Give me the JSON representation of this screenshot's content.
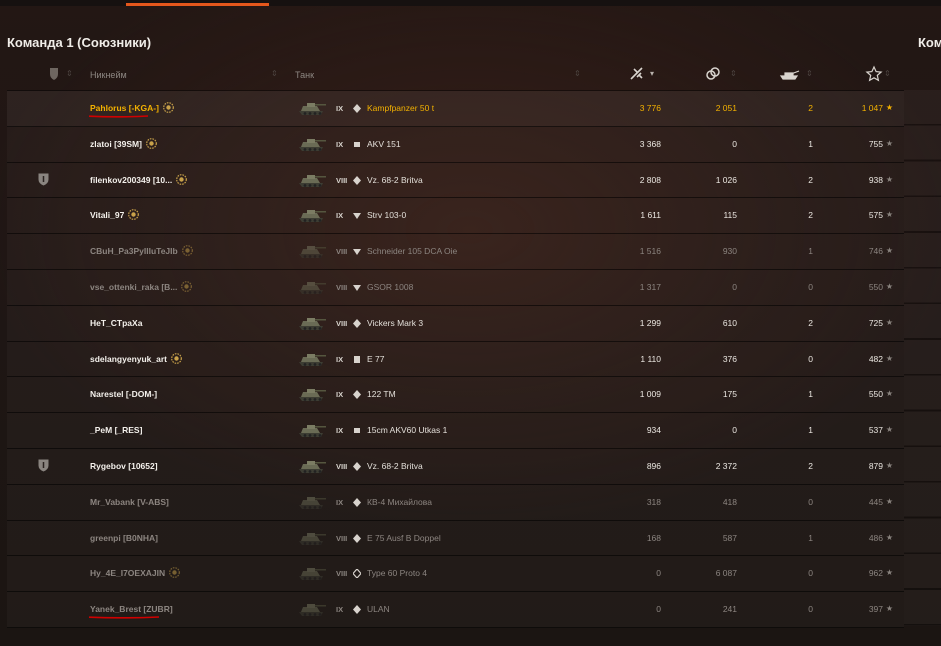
{
  "team": {
    "title": "Команда 1 (Союзники)",
    "right_title": "Ком"
  },
  "columns": {
    "nickname": "Никнейм",
    "tank": "Танк",
    "damage_icon": "damage-icon",
    "assist_icon": "assist-icon",
    "kills_icon": "kills-icon",
    "xp_icon": "star-icon"
  },
  "colors": {
    "accent": "#e4571c",
    "highlight": "#f2b100",
    "underline": "#d00000"
  },
  "players": [
    {
      "nick": "Pahlorus [-KGA-]",
      "tier": "IX",
      "tank_class": "medium",
      "tank": "Kampfpanzer 50 t",
      "damage": "3 776",
      "assist": "2 051",
      "kills": "2",
      "xp": "1 047",
      "highlight": true,
      "dim": false,
      "badge": true,
      "clan_icon": false,
      "underline": true
    },
    {
      "nick": "zlatoi [39SM]",
      "tier": "IX",
      "tank_class": "heavy",
      "tank": "AKV 151",
      "damage": "3 368",
      "assist": "0",
      "kills": "1",
      "xp": "755",
      "highlight": false,
      "dim": false,
      "badge": true,
      "clan_icon": false,
      "underline": false
    },
    {
      "nick": "filenkov200349 [10...",
      "tier": "VIII",
      "tank_class": "medium",
      "tank": "Vz. 68-2 Britva",
      "damage": "2 808",
      "assist": "1 026",
      "kills": "2",
      "xp": "938",
      "highlight": false,
      "dim": false,
      "badge": true,
      "clan_icon": true,
      "underline": false
    },
    {
      "nick": "Vitali_97",
      "tier": "IX",
      "tank_class": "td",
      "tank": "Strv 103-0",
      "damage": "1 611",
      "assist": "115",
      "kills": "2",
      "xp": "575",
      "highlight": false,
      "dim": false,
      "badge": true,
      "clan_icon": false,
      "underline": false
    },
    {
      "nick": "CBuH_Pa3PyIIIuTeJIb",
      "tier": "VIII",
      "tank_class": "td",
      "tank": "Schneider 105 DCA Oie",
      "damage": "1 516",
      "assist": "930",
      "kills": "1",
      "xp": "746",
      "highlight": false,
      "dim": true,
      "badge": true,
      "clan_icon": false,
      "underline": false
    },
    {
      "nick": "vse_ottenki_raka [B...",
      "tier": "VIII",
      "tank_class": "td",
      "tank": "GSOR 1008",
      "damage": "1 317",
      "assist": "0",
      "kills": "0",
      "xp": "550",
      "highlight": false,
      "dim": true,
      "badge": true,
      "clan_icon": false,
      "underline": false
    },
    {
      "nick": "HeT_CTpaXa",
      "tier": "VIII",
      "tank_class": "medium",
      "tank": "Vickers Mark 3",
      "damage": "1 299",
      "assist": "610",
      "kills": "2",
      "xp": "725",
      "highlight": false,
      "dim": false,
      "badge": false,
      "clan_icon": false,
      "underline": false
    },
    {
      "nick": "sdelangyenyuk_art",
      "tier": "IX",
      "tank_class": "spg",
      "tank": "E 77",
      "damage": "1 110",
      "assist": "376",
      "kills": "0",
      "xp": "482",
      "highlight": false,
      "dim": false,
      "badge": true,
      "clan_icon": false,
      "underline": false
    },
    {
      "nick": "Narestel [-DOM-]",
      "tier": "IX",
      "tank_class": "medium",
      "tank": "122 TM",
      "damage": "1 009",
      "assist": "175",
      "kills": "1",
      "xp": "550",
      "highlight": false,
      "dim": false,
      "badge": false,
      "clan_icon": false,
      "underline": false
    },
    {
      "nick": "_PeM [_RES]",
      "tier": "IX",
      "tank_class": "heavy",
      "tank": "15cm AKV60 Utkas 1",
      "damage": "934",
      "assist": "0",
      "kills": "1",
      "xp": "537",
      "highlight": false,
      "dim": false,
      "badge": false,
      "clan_icon": false,
      "underline": false
    },
    {
      "nick": "Rygebov [10652]",
      "tier": "VIII",
      "tank_class": "medium",
      "tank": "Vz. 68-2 Britva",
      "damage": "896",
      "assist": "2 372",
      "kills": "2",
      "xp": "879",
      "highlight": false,
      "dim": false,
      "badge": false,
      "clan_icon": true,
      "underline": false
    },
    {
      "nick": "Mr_Vabank [V-ABS]",
      "tier": "IX",
      "tank_class": "medium",
      "tank": "КВ-4 Михайлова",
      "damage": "318",
      "assist": "418",
      "kills": "0",
      "xp": "445",
      "highlight": false,
      "dim": true,
      "badge": false,
      "clan_icon": false,
      "underline": false
    },
    {
      "nick": "greenpi [B0NHA]",
      "tier": "VIII",
      "tank_class": "medium",
      "tank": "E 75 Ausf B Doppel",
      "damage": "168",
      "assist": "587",
      "kills": "1",
      "xp": "486",
      "highlight": false,
      "dim": true,
      "badge": false,
      "clan_icon": false,
      "underline": false
    },
    {
      "nick": "Hy_4E_I7OEXAJIN",
      "tier": "VIII",
      "tank_class": "light",
      "tank": "Type 60 Proto 4",
      "damage": "0",
      "assist": "6 087",
      "kills": "0",
      "xp": "962",
      "highlight": false,
      "dim": true,
      "badge": true,
      "clan_icon": false,
      "underline": false
    },
    {
      "nick": "Yanek_Brest [ZUBR]",
      "tier": "IX",
      "tank_class": "medium",
      "tank": "ULAN",
      "damage": "0",
      "assist": "241",
      "kills": "0",
      "xp": "397",
      "highlight": false,
      "dim": true,
      "badge": false,
      "clan_icon": false,
      "underline": true
    }
  ]
}
